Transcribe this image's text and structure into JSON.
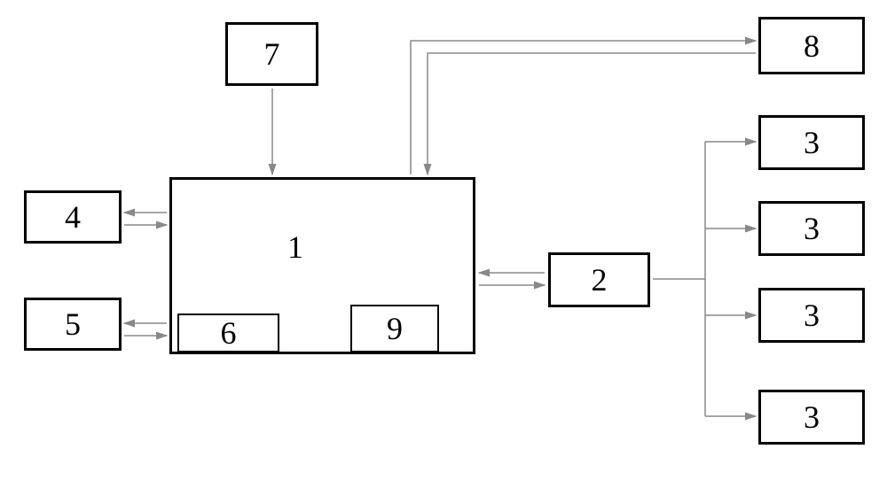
{
  "b1": "1",
  "b2": "2",
  "b3a": "3",
  "b3b": "3",
  "b3c": "3",
  "b3d": "3",
  "b4": "4",
  "b5": "5",
  "b6": "6",
  "b7": "7",
  "b8": "8",
  "b9": "9"
}
